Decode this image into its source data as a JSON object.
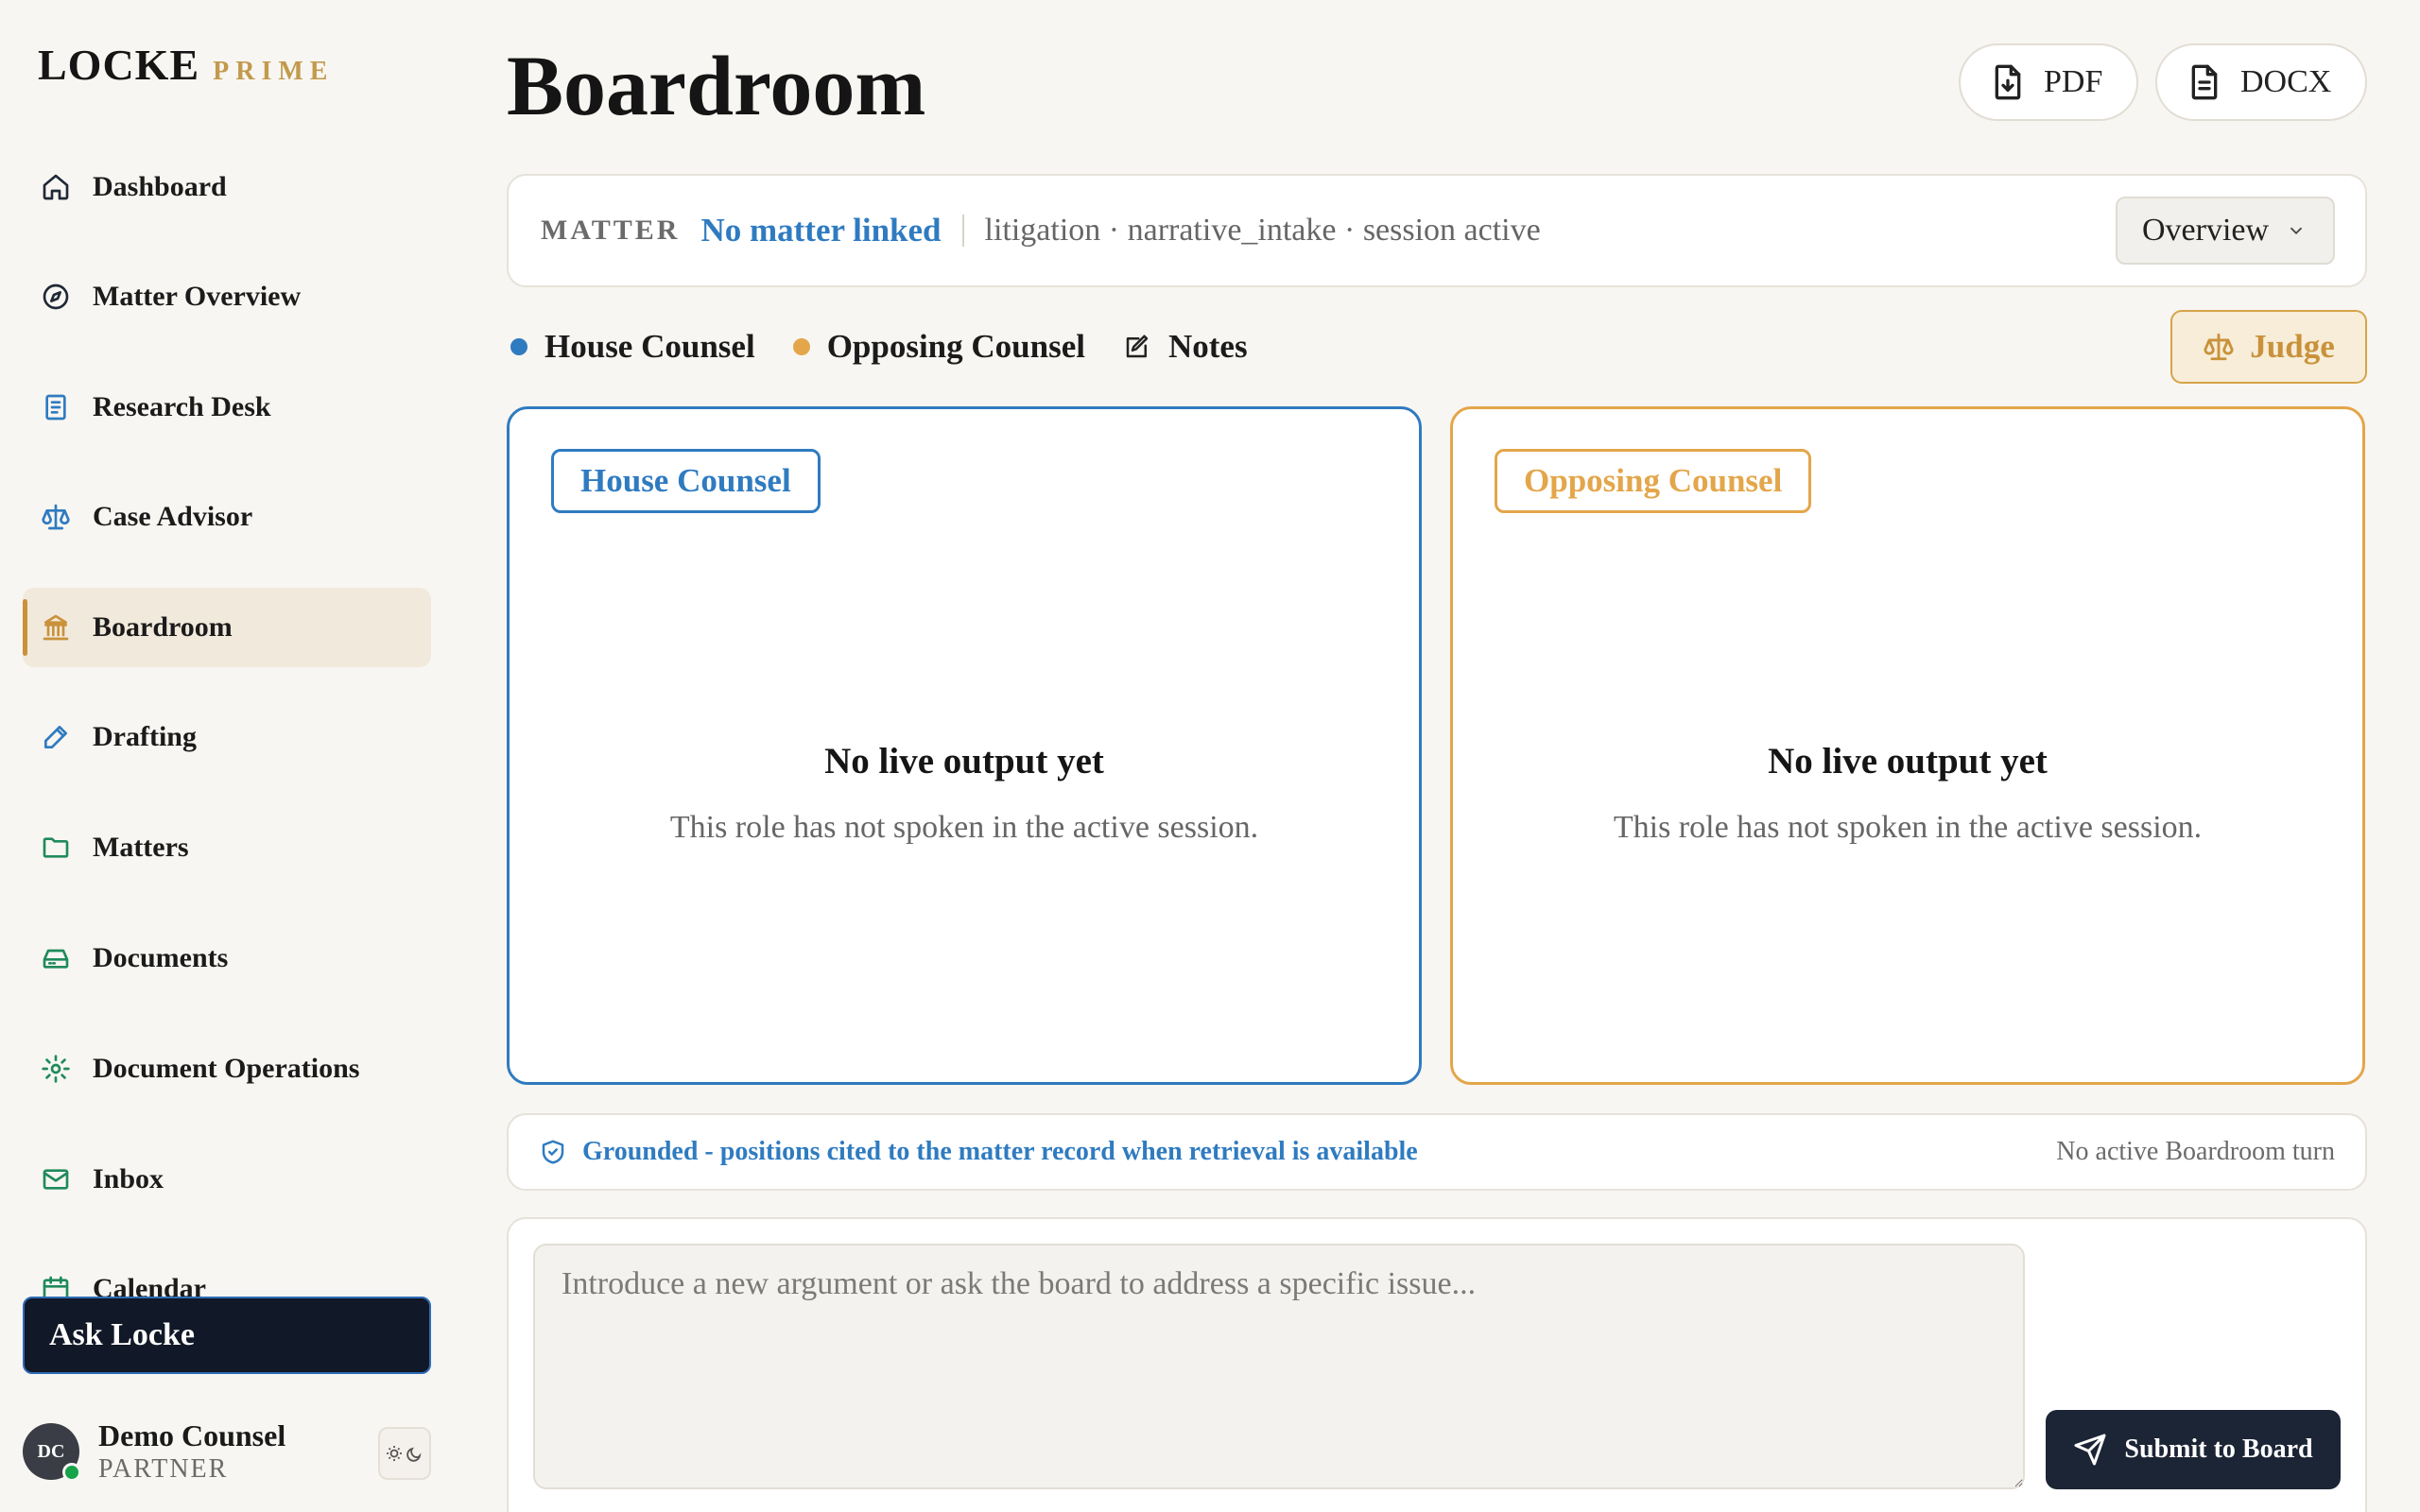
{
  "brand": {
    "name": "LOCKE",
    "tier": "PRIME"
  },
  "sidebar": {
    "items": [
      {
        "label": "Dashboard",
        "icon": "home-icon",
        "color": "#1f2937"
      },
      {
        "label": "Matter Overview",
        "icon": "compass-icon",
        "color": "#1f2937"
      },
      {
        "label": "Research Desk",
        "icon": "book-icon",
        "color": "#2f7bc0"
      },
      {
        "label": "Case Advisor",
        "icon": "scale-icon",
        "color": "#2f7bc0"
      },
      {
        "label": "Boardroom",
        "icon": "landmark-icon",
        "color": "#c9923a",
        "active": true
      },
      {
        "label": "Drafting",
        "icon": "pen-icon",
        "color": "#2f7bc0"
      },
      {
        "label": "Matters",
        "icon": "folder-icon",
        "color": "#1f8a5b"
      },
      {
        "label": "Documents",
        "icon": "drive-icon",
        "color": "#1f8a5b"
      },
      {
        "label": "Document Operations",
        "icon": "gear-icon",
        "color": "#1f8a5b"
      },
      {
        "label": "Inbox",
        "icon": "mail-icon",
        "color": "#1f8a5b"
      },
      {
        "label": "Calendar",
        "icon": "calendar-icon",
        "color": "#1f8a5b"
      }
    ],
    "ask_button": "Ask Locke",
    "user": {
      "initials": "DC",
      "name": "Demo Counsel",
      "role": "PARTNER"
    }
  },
  "header": {
    "title": "Boardroom",
    "export_pdf": "PDF",
    "export_docx": "DOCX"
  },
  "matter": {
    "key": "MATTER",
    "value": "No matter linked",
    "meta": "litigation · narrative_intake · session active",
    "view_select": "Overview"
  },
  "legend": {
    "house": "House Counsel",
    "opposing": "Opposing Counsel",
    "notes": "Notes",
    "judge": "Judge"
  },
  "colors": {
    "house": "#2f7bc0",
    "opposing": "#e3a64a",
    "judge": "#c9923a",
    "accent_dark": "#111827"
  },
  "panels": {
    "house": {
      "tag": "House Counsel",
      "empty_title": "No live output yet",
      "empty_text": "This role has not spoken in the active session."
    },
    "opposing": {
      "tag": "Opposing Counsel",
      "empty_title": "No live output yet",
      "empty_text": "This role has not spoken in the active session."
    }
  },
  "grounded": {
    "text": "Grounded - positions cited to the matter record when retrieval is available",
    "status": "No active Boardroom turn"
  },
  "compose": {
    "placeholder": "Introduce a new argument or ask the board to address a specific issue...",
    "value": "",
    "submit": "Submit to Board"
  }
}
